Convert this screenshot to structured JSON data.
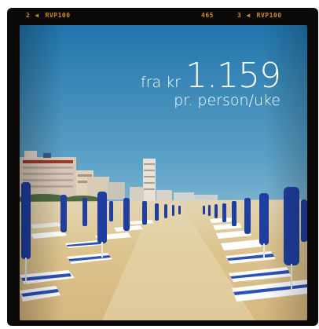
{
  "film_edge": {
    "left_number": "2",
    "left_code": "RVP100",
    "center_number": "465",
    "right_number": "3",
    "right_code": "RVP100"
  },
  "promo": {
    "prefix": "fra kr",
    "amount": "1.159",
    "unit": "pr. person/uke"
  },
  "colors": {
    "film": "#0b0a08",
    "edge_text": "#d08a2a",
    "umbrella_blue": "#1f3ea0",
    "sand": "#dcc391",
    "sky_top": "#2477ad",
    "sky_horizon": "#c5e0ea"
  }
}
